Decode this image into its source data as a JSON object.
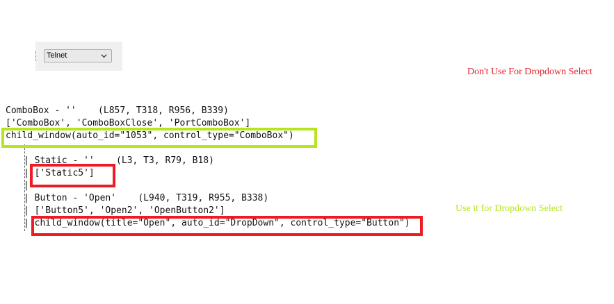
{
  "combo_preview": {
    "selected": "Telnet",
    "arrow_icon": "chevron-down-icon"
  },
  "notes": {
    "dont_use": "Don't Use For Dropdown Select",
    "use_it": "Use it for Dropdown Select"
  },
  "colors": {
    "red": "#ed1c24",
    "green": "#b5e61d",
    "note_red": "#e0202a"
  },
  "code": {
    "combo_line1": "ComboBox - ''    (L857, T318, R956, B339)",
    "combo_line2": "['ComboBox', 'ComboBoxClose', 'PortComboBox']",
    "combo_line3": "child_window(auto_id=\"1053\", control_type=\"ComboBox\")",
    "static_line1": "| Static - ''    (L3, T3, R79, B18)",
    "static_line2": "| ['Static5']",
    "static_line3": "|",
    "button_line1": "| Button - 'Open'    (L940, T319, R955, B338)",
    "button_line2": "| ['Button5', 'Open2', 'OpenButton2']",
    "button_line3": "| child_window(title=\"Open\", auto_id=\"DropDown\", control_type=\"Button\")"
  }
}
